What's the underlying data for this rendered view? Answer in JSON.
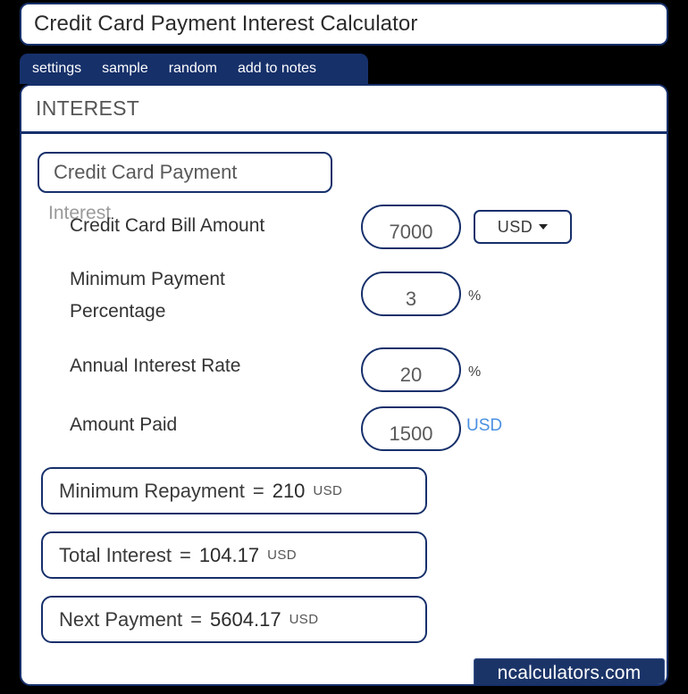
{
  "window": {
    "title": "Credit Card Payment Interest Calculator"
  },
  "tabs": [
    {
      "label": "settings"
    },
    {
      "label": "sample"
    },
    {
      "label": "random"
    },
    {
      "label": "add to notes"
    }
  ],
  "panel": {
    "section_header": "INTEREST",
    "subtitle": "Credit Card Payment",
    "ghost_label": "Interest"
  },
  "fields": [
    {
      "label": "Credit Card Bill Amount",
      "value": "7000",
      "unit": "",
      "currency_select": "USD"
    },
    {
      "label": "Minimum Payment Percentage",
      "value": "3",
      "unit": "%"
    },
    {
      "label": "Annual Interest Rate",
      "value": "20",
      "unit": "%"
    },
    {
      "label": "Amount Paid",
      "value": "1500",
      "unit": "USD"
    }
  ],
  "results": [
    {
      "label": "Minimum Repayment",
      "equals": "=",
      "value": "210",
      "unit": "USD"
    },
    {
      "label": "Total Interest",
      "equals": "=",
      "value": "104.17",
      "unit": "USD"
    },
    {
      "label": "Next Payment",
      "equals": "=",
      "value": "5604.17",
      "unit": "USD"
    }
  ],
  "footer": {
    "brand": "ncalculators.com"
  },
  "colors": {
    "navy": "#17306b",
    "tabbar": "#16306a",
    "accent_blue": "#4a90e2",
    "label_gray": "#333333"
  }
}
